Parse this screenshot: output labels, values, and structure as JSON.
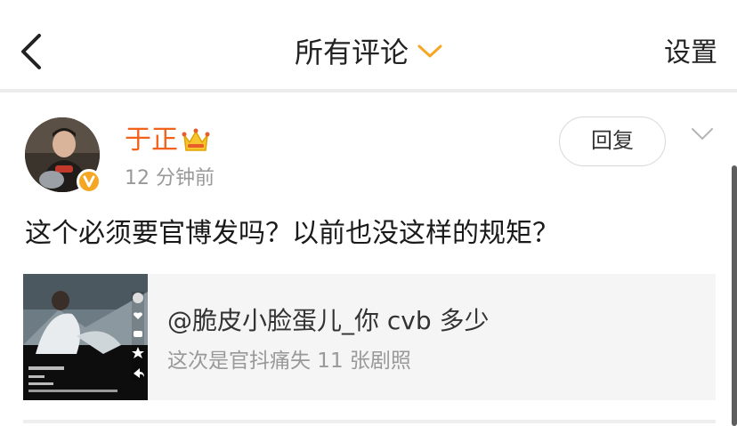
{
  "header": {
    "title": "所有评论",
    "settings_label": "设置"
  },
  "comment": {
    "username": "于正",
    "time": "12 分钟前",
    "reply_label": "回复",
    "text": "这个必须要官博发吗？以前也没这样的规矩？",
    "card": {
      "title": "@脆皮小脸蛋儿_你 cvb 多少",
      "subtitle": "这次是官抖痛失 11 张剧照"
    }
  },
  "colors": {
    "accent_orange": "#f2621b",
    "chevron_orange": "#f5a623",
    "verified_badge": "#f5a623"
  },
  "icons": {
    "back": "back-arrow-icon",
    "title_dropdown": "chevron-down-icon",
    "crown": "crown-icon",
    "verified": "verified-badge-icon",
    "more": "chevron-down-icon"
  }
}
